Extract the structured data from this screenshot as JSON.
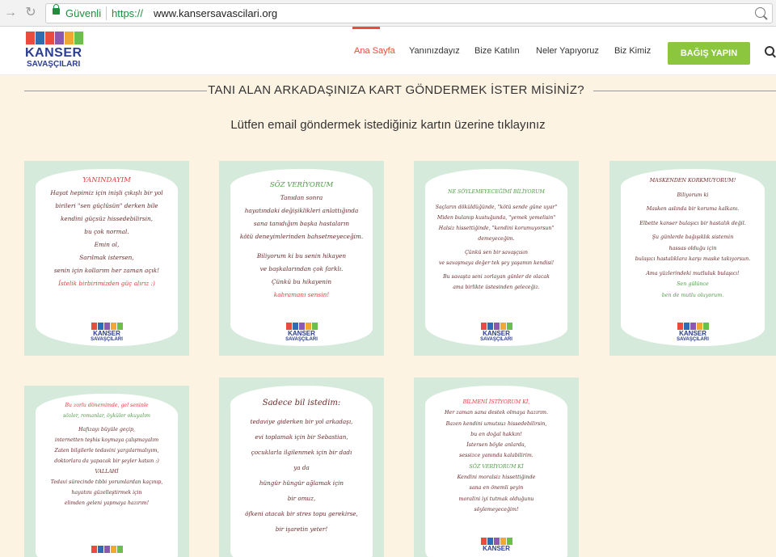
{
  "browser": {
    "secure_label": "Güvenli",
    "url_scheme": "https://",
    "url_host": "www.kansersavascilari.org"
  },
  "logo": {
    "word1": "KANSER",
    "word2": "SAVAŞÇILARI"
  },
  "nav": {
    "items": [
      "Ana Sayfa",
      "Yanınızdayız",
      "Bize Katılın",
      "Neler Yapıyoruz",
      "Biz Kimiz"
    ],
    "donate_label": "BAĞIŞ YAPIN"
  },
  "headline": "TANI ALAN ARKADAŞINIZA KART GÖNDERMEK İSTER MİSİNİZ?",
  "subline": "Lütfen email göndermek istediğiniz kartın üzerine tıklayınız",
  "colors": {
    "accent_red": "#e74c3c",
    "donate_green": "#8cc63f",
    "card_bg": "#d5eadb",
    "page_bg": "#fdf3e3",
    "logo_blue": "#2c3e8f"
  },
  "cards": [
    {
      "lines": [
        "YANINDAYIM",
        "Hayat hepimiz için inişli çıkışlı bir yol",
        "birileri \"sen güçlüsün\" derken bile",
        "kendini güçsüz hissedebilirsin,",
        "bu çok normal.",
        "Emin ol,",
        "Sarılmak istersen,",
        "senin için kollarım her zaman açık!",
        "İstelik birbirimizden güç alırız :)"
      ]
    },
    {
      "lines": [
        "SÖZ VERİYORUM",
        "Tanıdan sonra",
        "hayatındaki değişiklikleri anlattığında",
        "sana tanıdığım başka hastaların",
        "kötü deneyimlerinden bahsetmeyeceğim.",
        "Biliyorum ki bu senin hikayen",
        "ve başkalarından çok farklı.",
        "Çünkü bu hikayenin",
        "kahramanı sensin!"
      ]
    },
    {
      "lines": [
        "NE SÖYLEMEYECEĞİMİ BİLİYORUM",
        "Saçların döküldüğünde, \"kötü sende güne uyar\"",
        "Miden bulanıp kustuğunda, \"yemek yemelisin\"",
        "Halsiz hissettiğinde, \"kendini korumuyorsun\"",
        "demeyeceğim.",
        "Çünkü sen bir savaşçısın",
        "ve savaşmaya değer tek şey yaşamın kendisi!",
        "Bu savaşta seni zorlayan günler de olacak",
        "ama birlikte üstesinden geleceğiz."
      ]
    },
    {
      "lines": [
        "MASKENDEN KORKMUYORUM!",
        "Biliyorum ki",
        "Masken aslında bir koruma kalkanı.",
        "Elbette kanser bulaşıcı bir hastalık değil.",
        "Şu günlerde bağışıklık sistemin",
        "hassas olduğu için",
        "bulaşıcı hastalıklara karşı maske takıyorsun.",
        "Ama yüzlerindeki mutluluk bulaşıcı!",
        "Sen gülünce",
        "ben de mutlu oluyorum."
      ]
    },
    {
      "lines": [
        "Bu zorlu dönemimde, gel seninle",
        "sözler, romanlar, öyküler okuyalım",
        "Hafızayı büyüle geçip,",
        "internetten teşhis koymaya çalışmayalım",
        "Zaten bilgilerle tedavini yargılarmalıyım,",
        "doktorlara da yapacak bir şeyler katsın :)",
        "VALLAHİ",
        "Tedavi sürecinde tıbbi yorumlardan kaçınıp,",
        "hayatını güzelleştirmek için",
        "elimden geleni yapmaya hazırım!"
      ]
    },
    {
      "lines": [
        "Sadece bil istedim:",
        "tedaviye giderken bir yol arkadaşı,",
        "evi toplamak için bir Sebastian,",
        "çocuklarla ilgilenmek için bir dadı",
        "ya da",
        "hüngür hüngür ağlamak için",
        "bir omuz,",
        "öfkeni atacak bir stres topu gerekirse,",
        "bir işaretin yeter!"
      ]
    },
    {
      "lines": [
        "BİLMENİ İSTİYORUM Kİ,",
        "Her zaman sana destek olmaya hazırım.",
        "Bazen kendini umutsuz hissedebilirsin,",
        "bu en doğal hakkın!",
        "İstersen böyle anlarda,",
        "sessizce yanında kalabilirim.",
        "SÖZ VERİYORUM Kİ",
        "Kendini moralsiz hissettiğinde",
        "sana en önemli şeyin",
        "moralini iyi tutmak olduğunu",
        "söylemeyeceğim!"
      ]
    }
  ]
}
